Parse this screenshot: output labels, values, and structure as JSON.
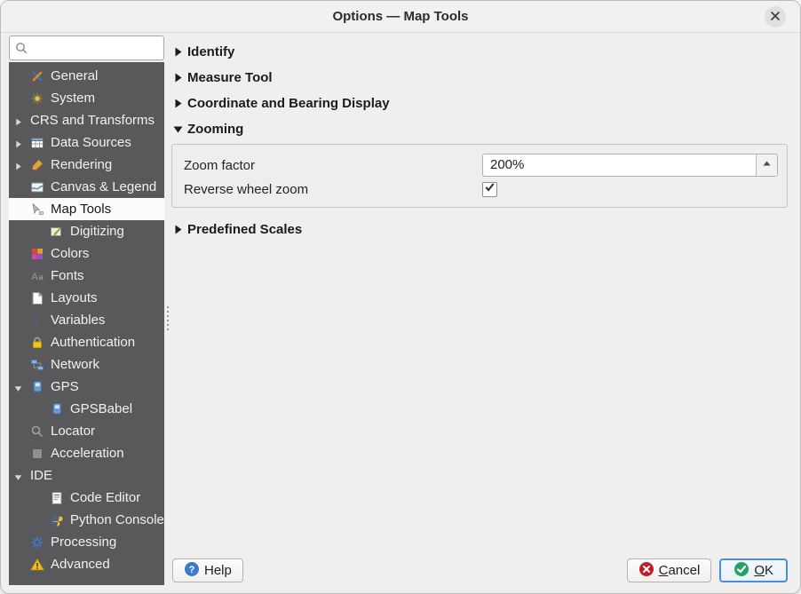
{
  "window": {
    "title": "Options — Map Tools"
  },
  "sidebar": {
    "search": {
      "placeholder": "",
      "value": ""
    },
    "items": [
      {
        "label": "General",
        "icon": "general",
        "level": 0
      },
      {
        "label": "System",
        "icon": "system",
        "level": 0
      },
      {
        "label": "CRS and Transforms",
        "icon": null,
        "level": 0,
        "expander": "collapsed"
      },
      {
        "label": "Data Sources",
        "icon": "data-sources",
        "level": 0,
        "expander": "collapsed"
      },
      {
        "label": "Rendering",
        "icon": "rendering",
        "level": 0,
        "expander": "collapsed"
      },
      {
        "label": "Canvas & Legend",
        "icon": "canvas-legend",
        "level": 0
      },
      {
        "label": "Map Tools",
        "icon": "map-tools",
        "level": 0,
        "selected": true
      },
      {
        "label": "Digitizing",
        "icon": "digitizing",
        "level": 1
      },
      {
        "label": "Colors",
        "icon": "colors",
        "level": 0
      },
      {
        "label": "Fonts",
        "icon": "fonts",
        "level": 0
      },
      {
        "label": "Layouts",
        "icon": "layouts",
        "level": 0
      },
      {
        "label": "Variables",
        "icon": "variables",
        "level": 0
      },
      {
        "label": "Authentication",
        "icon": "authentication",
        "level": 0
      },
      {
        "label": "Network",
        "icon": "network",
        "level": 0
      },
      {
        "label": "GPS",
        "icon": "gps",
        "level": 0,
        "expander": "expanded"
      },
      {
        "label": "GPSBabel",
        "icon": "gpsbabel",
        "level": 1
      },
      {
        "label": "Locator",
        "icon": "locator",
        "level": 0
      },
      {
        "label": "Acceleration",
        "icon": "acceleration",
        "level": 0
      },
      {
        "label": "IDE",
        "icon": null,
        "level": 0,
        "expander": "expanded"
      },
      {
        "label": "Code Editor",
        "icon": "code-editor",
        "level": 1
      },
      {
        "label": "Python Console",
        "icon": "python",
        "level": 1
      },
      {
        "label": "Processing",
        "icon": "processing",
        "level": 0
      },
      {
        "label": "Advanced",
        "icon": "advanced",
        "level": 0
      }
    ]
  },
  "main": {
    "sections": [
      {
        "label": "Identify",
        "expanded": false
      },
      {
        "label": "Measure Tool",
        "expanded": false
      },
      {
        "label": "Coordinate and Bearing Display",
        "expanded": false
      },
      {
        "label": "Zooming",
        "expanded": true
      },
      {
        "label": "Predefined Scales",
        "expanded": false
      }
    ],
    "zooming": {
      "zoom_factor_label": "Zoom factor",
      "zoom_factor_value": "200%",
      "reverse_wheel_label": "Reverse wheel zoom",
      "reverse_wheel_checked": true
    }
  },
  "footer": {
    "help_label": "Help",
    "cancel_label": "Cancel",
    "ok_label": "OK",
    "cancel_mnemonic": "C",
    "ok_mnemonic": "O"
  },
  "colors": {
    "sidebar_bg": "#59595b",
    "selection_bg": "#fcfcfc",
    "focus_accent": "#4a90d9",
    "ok_green": "#26a269",
    "cancel_red": "#c01c28",
    "help_blue": "#3c7bc8",
    "warning_yellow": "#f5c211"
  }
}
